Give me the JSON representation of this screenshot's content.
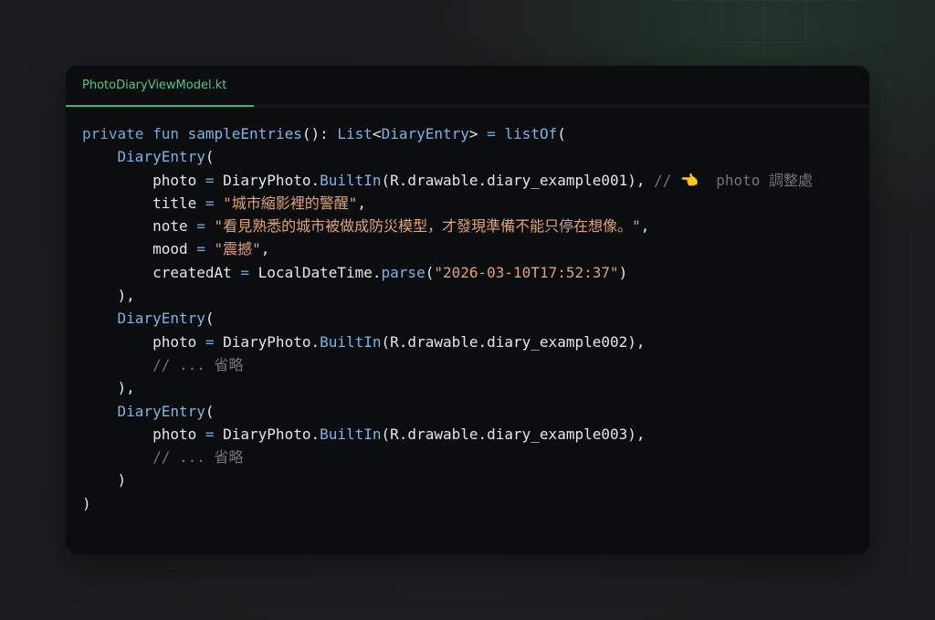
{
  "colors": {
    "background": "#1c1d1e",
    "editor_background": "#0c0d0e",
    "tab_accent": "#4ec98f",
    "keyword": "#6fa8dc",
    "type": "#7cb3e8",
    "string": "#e0a27d",
    "comment": "#6e767d",
    "plain": "#e4e6e8"
  },
  "editor": {
    "tab": {
      "label": "PhotoDiaryViewModel.kt"
    },
    "lines": [
      [
        {
          "t": "private",
          "c": "kw"
        },
        {
          "t": " ",
          "c": "pl"
        },
        {
          "t": "fun",
          "c": "kw"
        },
        {
          "t": " ",
          "c": "pl"
        },
        {
          "t": "sampleEntries",
          "c": "fn"
        },
        {
          "t": "(): ",
          "c": "pl"
        },
        {
          "t": "List",
          "c": "ty"
        },
        {
          "t": "<",
          "c": "pl"
        },
        {
          "t": "DiaryEntry",
          "c": "ty"
        },
        {
          "t": "> ",
          "c": "pl"
        },
        {
          "t": "=",
          "c": "op"
        },
        {
          "t": " ",
          "c": "pl"
        },
        {
          "t": "listOf",
          "c": "fn"
        },
        {
          "t": "(",
          "c": "pl"
        }
      ],
      [
        {
          "t": "    ",
          "c": "pl"
        },
        {
          "t": "DiaryEntry",
          "c": "ty"
        },
        {
          "t": "(",
          "c": "pl"
        }
      ],
      [
        {
          "t": "        photo ",
          "c": "pl"
        },
        {
          "t": "=",
          "c": "op"
        },
        {
          "t": " DiaryPhoto.",
          "c": "pl"
        },
        {
          "t": "BuiltIn",
          "c": "fn"
        },
        {
          "t": "(R.drawable.diary_example001), ",
          "c": "pl"
        },
        {
          "t": "// 👈  photo 調整處",
          "c": "cmt"
        }
      ],
      [
        {
          "t": "        title ",
          "c": "pl"
        },
        {
          "t": "=",
          "c": "op"
        },
        {
          "t": " ",
          "c": "pl"
        },
        {
          "t": "\"城市縮影裡的警醒\"",
          "c": "str"
        },
        {
          "t": ",",
          "c": "pl"
        }
      ],
      [
        {
          "t": "        note ",
          "c": "pl"
        },
        {
          "t": "=",
          "c": "op"
        },
        {
          "t": " ",
          "c": "pl"
        },
        {
          "t": "\"看見熟悉的城市被做成防災模型，才發現準備不能只停在想像。\"",
          "c": "str"
        },
        {
          "t": ",",
          "c": "pl"
        }
      ],
      [
        {
          "t": "        mood ",
          "c": "pl"
        },
        {
          "t": "=",
          "c": "op"
        },
        {
          "t": " ",
          "c": "pl"
        },
        {
          "t": "\"震撼\"",
          "c": "str"
        },
        {
          "t": ",",
          "c": "pl"
        }
      ],
      [
        {
          "t": "        createdAt ",
          "c": "pl"
        },
        {
          "t": "=",
          "c": "op"
        },
        {
          "t": " LocalDateTime.",
          "c": "pl"
        },
        {
          "t": "parse",
          "c": "fn"
        },
        {
          "t": "(",
          "c": "pl"
        },
        {
          "t": "\"2026-03-10T17:52:37\"",
          "c": "str"
        },
        {
          "t": ")",
          "c": "pl"
        }
      ],
      [
        {
          "t": "    ),",
          "c": "pl"
        }
      ],
      [
        {
          "t": "    ",
          "c": "pl"
        },
        {
          "t": "DiaryEntry",
          "c": "ty"
        },
        {
          "t": "(",
          "c": "pl"
        }
      ],
      [
        {
          "t": "        photo ",
          "c": "pl"
        },
        {
          "t": "=",
          "c": "op"
        },
        {
          "t": " DiaryPhoto.",
          "c": "pl"
        },
        {
          "t": "BuiltIn",
          "c": "fn"
        },
        {
          "t": "(R.drawable.diary_example002),",
          "c": "pl"
        }
      ],
      [
        {
          "t": "        ",
          "c": "pl"
        },
        {
          "t": "// ... 省略",
          "c": "cmt"
        }
      ],
      [
        {
          "t": "    ),",
          "c": "pl"
        }
      ],
      [
        {
          "t": "    ",
          "c": "pl"
        },
        {
          "t": "DiaryEntry",
          "c": "ty"
        },
        {
          "t": "(",
          "c": "pl"
        }
      ],
      [
        {
          "t": "        photo ",
          "c": "pl"
        },
        {
          "t": "=",
          "c": "op"
        },
        {
          "t": " DiaryPhoto.",
          "c": "pl"
        },
        {
          "t": "BuiltIn",
          "c": "fn"
        },
        {
          "t": "(R.drawable.diary_example003),",
          "c": "pl"
        }
      ],
      [
        {
          "t": "        ",
          "c": "pl"
        },
        {
          "t": "// ... 省略",
          "c": "cmt"
        }
      ],
      [
        {
          "t": "    )",
          "c": "pl"
        }
      ],
      [
        {
          "t": ")",
          "c": "pl"
        }
      ]
    ]
  }
}
